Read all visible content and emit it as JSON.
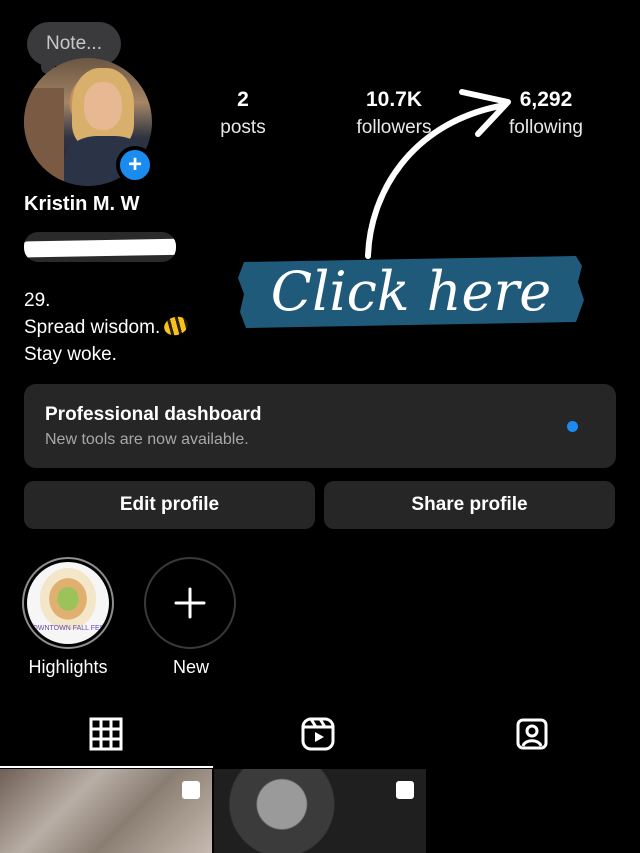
{
  "note": {
    "text": "Note..."
  },
  "profile": {
    "name": "Kristin M. W",
    "bio_lines": [
      "29.",
      "Spread wisdom.",
      "Stay woke."
    ]
  },
  "stats": [
    {
      "value": "2",
      "label": "posts"
    },
    {
      "value": "10.7K",
      "label": "followers"
    },
    {
      "value": "6,292",
      "label": "following"
    }
  ],
  "overlay": {
    "text": "Click here",
    "banner_color": "#1f5a7a"
  },
  "dashboard": {
    "title": "Professional dashboard",
    "subtitle": "New tools are now available.",
    "dot_color": "#1a8cf0"
  },
  "buttons": {
    "edit": "Edit profile",
    "share": "Share profile"
  },
  "highlights": [
    {
      "label": "Highlights",
      "caption": "DOWNTOWN FALL FEST"
    },
    {
      "label": "New"
    }
  ],
  "tabs": [
    {
      "icon": "grid-icon"
    },
    {
      "icon": "reels-icon"
    },
    {
      "icon": "tagged-icon"
    }
  ],
  "colors": {
    "accent": "#1a8cf0",
    "surface": "#262626",
    "background": "#000000"
  }
}
